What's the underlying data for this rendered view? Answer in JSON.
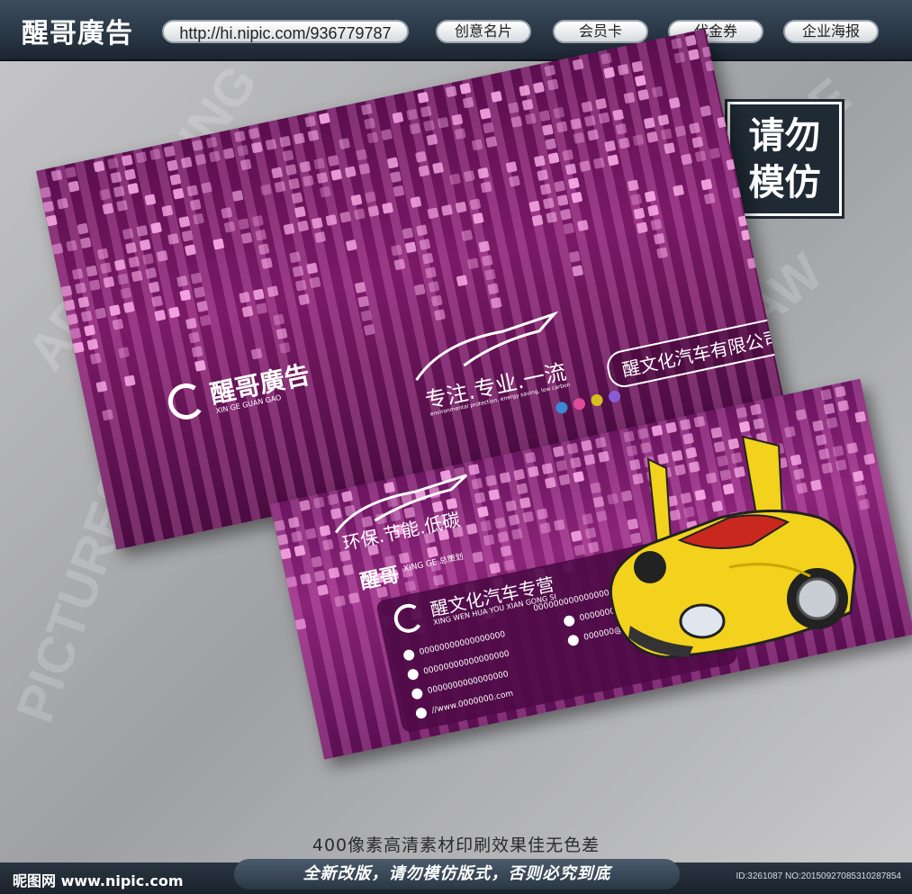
{
  "header": {
    "brand": "醒哥廣告",
    "url": "http://hi.nipic.com/936779787",
    "nav": [
      "创意名片",
      "会员卡",
      "代金券",
      "企业海报"
    ]
  },
  "stamp": {
    "line1": "请勿",
    "line2": "模仿"
  },
  "back_card": {
    "logo_text": "醒哥廣告",
    "logo_sub": "XIN GE GUAN GAO",
    "slogan": "专注.专业.一流",
    "slogan_sub": "environmental protection, energy saving, low carbon",
    "company": "醒文化汽车有限公司"
  },
  "front_card": {
    "slogan": "环保.节能.低碳",
    "planner": "醒哥",
    "planner_sub": "XING GE 总策划",
    "company": "醒文化汽车专营",
    "company_sub": "XING WEN HUA YOU XIAN GONG SI",
    "phone1": "00000000000000000",
    "email": "000000@00.com",
    "phone2": "00000000000000000",
    "phone3": "0000000000000000",
    "qq": "00000000000000000",
    "web": "//www.0000000.com",
    "long_number": "000000000000000000000000000000000000"
  },
  "caption": "400像素高清素材印刷效果佳无色差",
  "footer": {
    "logo": "昵图网 www.nipic.com",
    "slogan": "全新改版，请勿模仿版式，否则必究到底",
    "id": "ID:3261087 NO:20150927085310287854"
  },
  "colors": {
    "purple": "#7a1a67",
    "pink": "#f6a9e4",
    "header": "#26323f",
    "car_yellow": "#f2d21c"
  }
}
